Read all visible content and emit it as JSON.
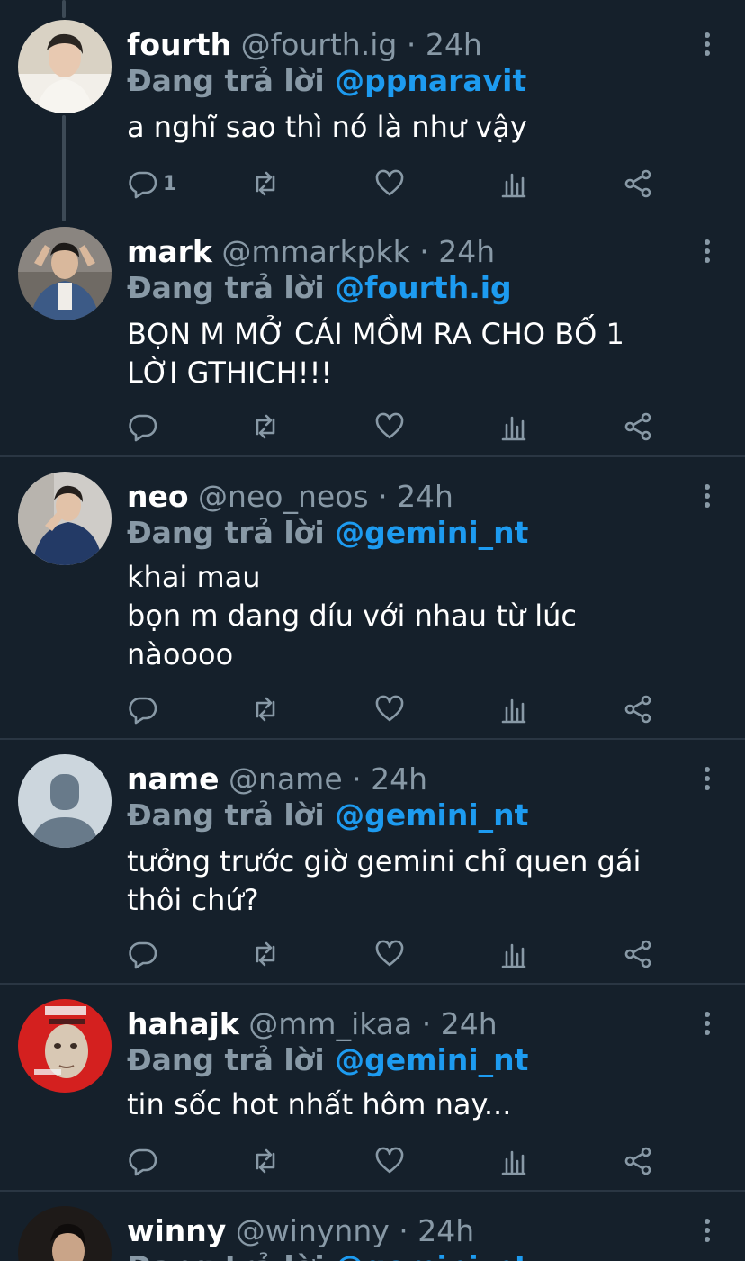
{
  "reply_prefix": "Đang trả lời",
  "colors": {
    "background": "#15202b",
    "accent": "#1d9bf0",
    "muted": "#8899a6",
    "separator": "#2a3643"
  },
  "icons": {
    "reply": "comment-icon",
    "retweet": "retweet-icon",
    "like": "heart-icon",
    "stats": "analytics-icon",
    "share": "share-icon",
    "more": "more-vertical-icon"
  },
  "tweets": [
    {
      "name": "fourth",
      "handle": "@fourth.ig",
      "dot": "·",
      "time": "24h",
      "reply_to": "@ppnaravit",
      "text": "a nghĩ sao thì nó là như vậy",
      "reply_count": "1"
    },
    {
      "name": "mark",
      "handle": "@mmarkpkk",
      "dot": "·",
      "time": "24h",
      "reply_to": "@fourth.ig",
      "text": "BỌN M MỞ CÁI MỒM RA CHO BỐ 1\nLỜI GTHICH!!!",
      "reply_count": ""
    },
    {
      "name": "neo",
      "handle": "@neo_neos",
      "dot": "·",
      "time": "24h",
      "reply_to": "@gemini_nt",
      "text": "khai mau\nbọn m dang díu với nhau từ lúc\nnàoooo",
      "reply_count": ""
    },
    {
      "name": "name",
      "handle": "@name",
      "dot": "·",
      "time": "24h",
      "reply_to": "@gemini_nt",
      "text": "tưởng trước giờ gemini chỉ quen gái\nthôi chứ?",
      "reply_count": ""
    },
    {
      "name": "hahajk",
      "handle": "@mm_ikaa",
      "dot": "·",
      "time": "24h",
      "reply_to": "@gemini_nt",
      "text": "tin sốc hot nhất hôm nay...",
      "reply_count": ""
    },
    {
      "name": "winny",
      "handle": "@winynny",
      "dot": "·",
      "time": "24h",
      "reply_to": "@gemini_nt",
      "text": "",
      "reply_count": ""
    }
  ]
}
